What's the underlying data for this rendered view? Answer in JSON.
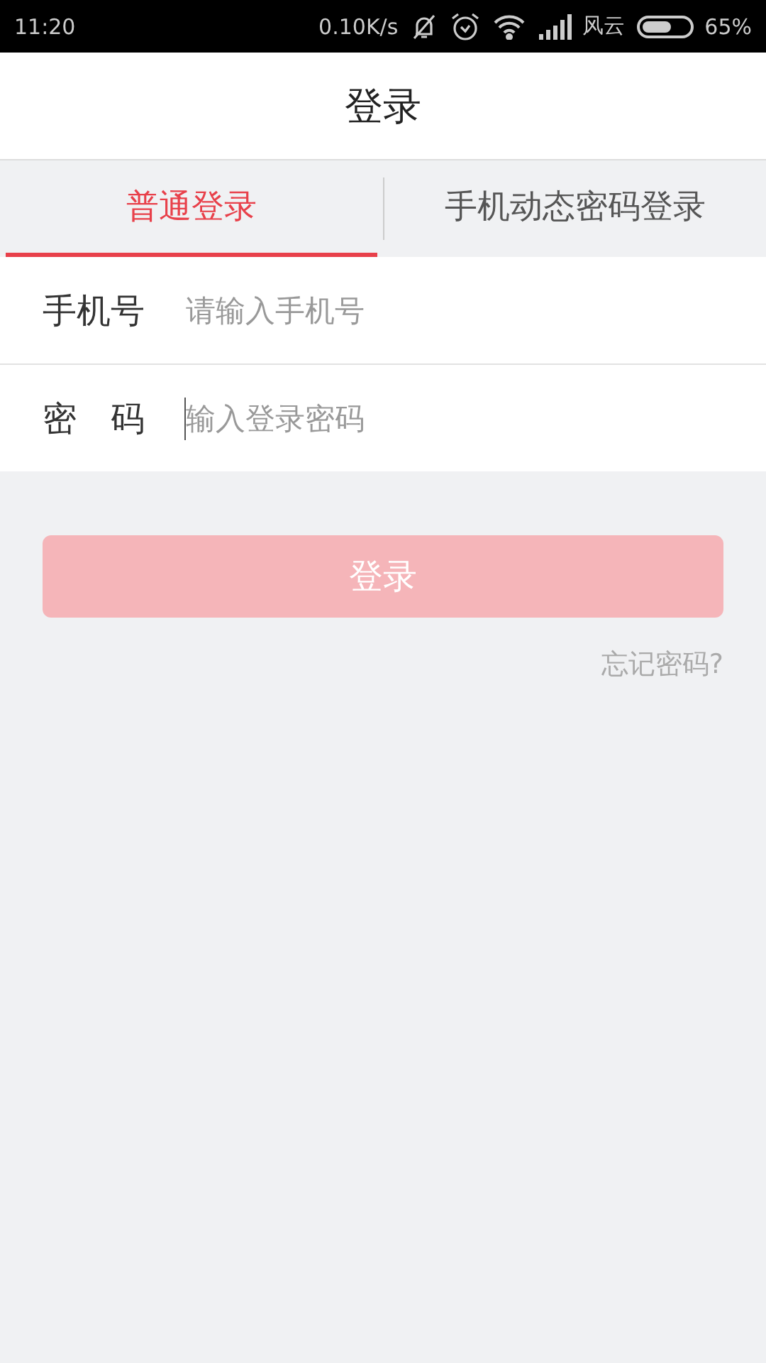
{
  "status_bar": {
    "time": "11:20",
    "net_speed": "0.10K/s",
    "carrier": "风云",
    "battery": {
      "level": 0.65,
      "percent": "65%"
    }
  },
  "header": {
    "title": "登录"
  },
  "tabs": [
    {
      "label": "普通登录",
      "selected": true
    },
    {
      "label": "手机动态密码登录",
      "selected": false
    }
  ],
  "fields": [
    {
      "label": "手机号",
      "placeholder": "请输入手机号",
      "focused": false
    },
    {
      "label": "密　码",
      "placeholder": "输入登录密码",
      "focused": true
    }
  ],
  "login_button": {
    "label": "登录",
    "disabled": true
  },
  "forgot_link": "忘记密码?"
}
